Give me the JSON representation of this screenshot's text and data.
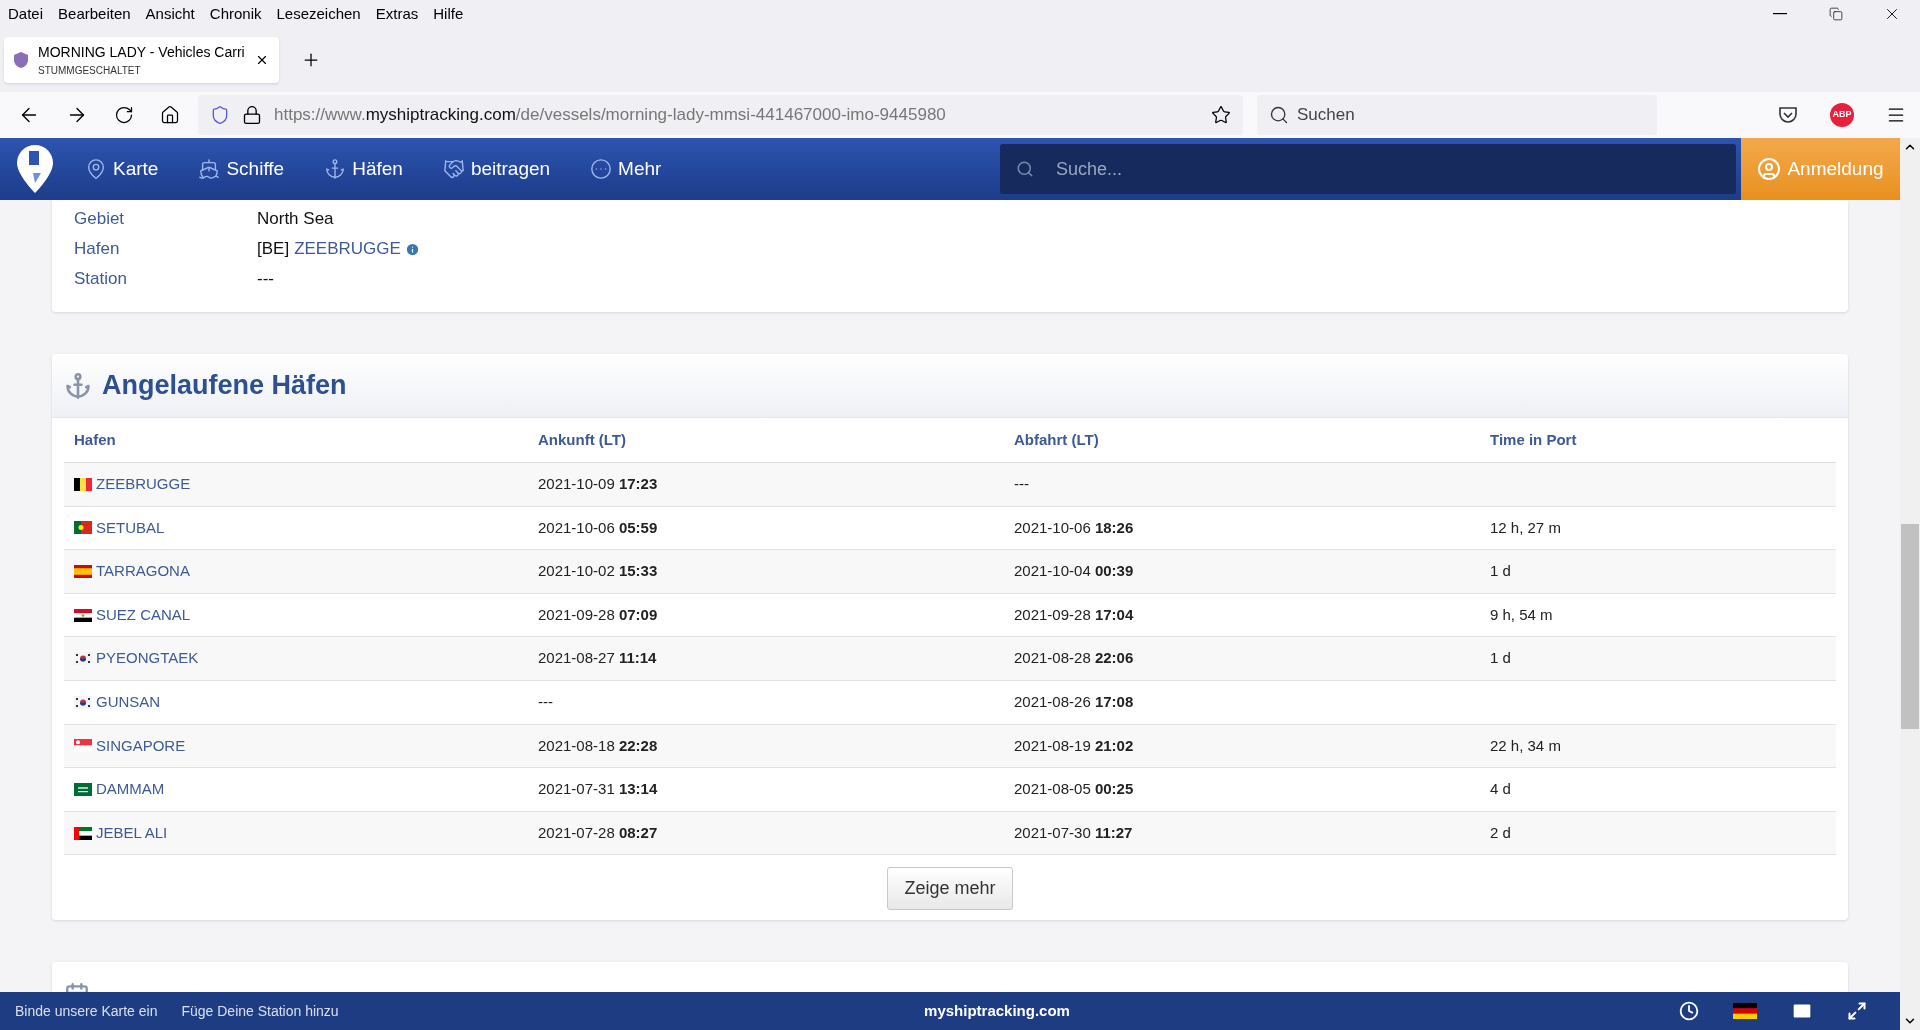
{
  "browser": {
    "menu": [
      "Datei",
      "Bearbeiten",
      "Ansicht",
      "Chronik",
      "Lesezeichen",
      "Extras",
      "Hilfe"
    ],
    "tab": {
      "title": "MORNING LADY - Vehicles Carri",
      "subtitle": "STUMMGESCHALTET"
    },
    "url": {
      "prefix": "https://www.",
      "domain": "myshiptracking.com",
      "path": "/de/vessels/morning-lady-mmsi-441467000-imo-9445980"
    },
    "search_placeholder": "Suchen",
    "adblock": "ABP"
  },
  "site": {
    "nav": [
      {
        "label": "Karte",
        "kind": "map"
      },
      {
        "label": "Schiffe",
        "kind": "ship"
      },
      {
        "label": "Häfen",
        "kind": "anchor"
      },
      {
        "label": "beitragen",
        "kind": "handshake"
      },
      {
        "label": "Mehr",
        "kind": "more"
      }
    ],
    "search_placeholder": "Suche...",
    "login": "Anmeldung"
  },
  "details": [
    {
      "label": "Gebiet",
      "value": "North Sea"
    },
    {
      "label": "Hafen",
      "value": "[BE]",
      "link": "ZEEBRUGGE"
    },
    {
      "label": "Station",
      "value": "---"
    }
  ],
  "ports": {
    "title": "Angelaufene Häfen",
    "columns": [
      "Hafen",
      "Ankunft (LT)",
      "Abfahrt (LT)",
      "Time in Port"
    ],
    "rows": [
      {
        "kind": "be",
        "port": "ZEEBRUGGE",
        "arrival": "2021-10-09 **17:23**",
        "departure": "---"
      },
      {
        "kind": "pt",
        "port": "SETUBAL",
        "arrival": "2021-10-06 **05:59**",
        "departure": "2021-10-06 **18:26**",
        "time_in_port": "12 h, 27 m"
      },
      {
        "kind": "es",
        "port": "TARRAGONA",
        "arrival": "2021-10-02 **15:33**",
        "departure": "2021-10-04 **00:39**",
        "time_in_port": "1 d"
      },
      {
        "kind": "eg",
        "port": "SUEZ CANAL",
        "arrival": "2021-09-28 **07:09**",
        "departure": "2021-09-28 **17:04**",
        "time_in_port": "9 h, 54 m"
      },
      {
        "kind": "kr",
        "port": "PYEONGTAEK",
        "arrival": "2021-08-27 **11:14**",
        "departure": "2021-08-28 **22:06**",
        "time_in_port": "1 d"
      },
      {
        "kind": "kr",
        "port": "GUNSAN",
        "arrival": "---",
        "departure": "2021-08-26 **17:08**"
      },
      {
        "kind": "sg",
        "port": "SINGAPORE",
        "arrival": "2021-08-18 **22:28**",
        "departure": "2021-08-19 **21:02**",
        "time_in_port": "22 h, 34 m"
      },
      {
        "kind": "sa",
        "port": "DAMMAM",
        "arrival": "2021-07-31 **13:14**",
        "departure": "2021-08-05 **00:25**",
        "time_in_port": "4 d"
      },
      {
        "kind": "ae",
        "port": "JEBEL ALI",
        "arrival": "2021-07-28 **08:27**",
        "departure": "2021-07-30 **11:27**",
        "time_in_port": "2 d"
      }
    ],
    "more_button": "Zeige mehr"
  },
  "footer": {
    "links": [
      "Binde unsere Karte ein",
      "Füge Deine Station hinzu"
    ],
    "brand": "myshiptracking.com"
  }
}
